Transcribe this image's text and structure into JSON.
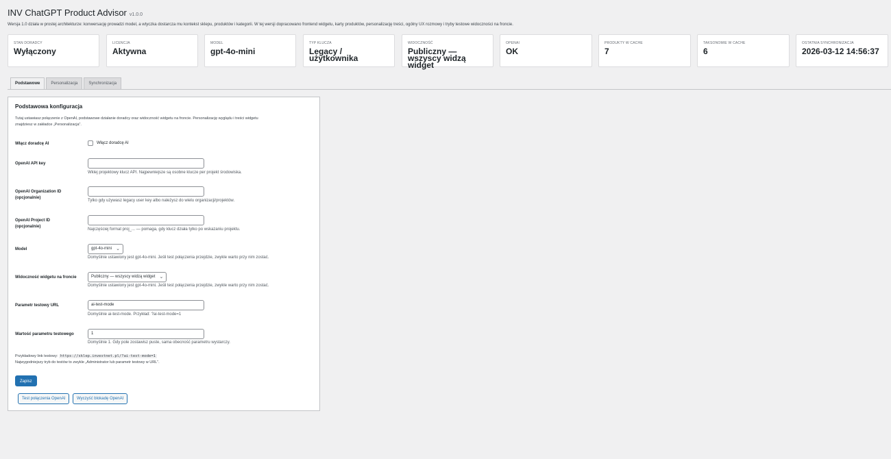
{
  "header": {
    "title": "INV ChatGPT Product Advisor",
    "version": "v1.0.0",
    "description": "Wersja 1.0 działa w prostej architekturze: konwersację prowadzi model, a wtyczka dostarcza mu kontekst sklepu, produktów i kategorii. W tej wersji dopracowano frontend widgetu, karty produktów, personalizację treści, ogólny UX rozmowy i tryby testowe widoczności na froncie."
  },
  "cards": [
    {
      "label": "Stan doradcy",
      "value": "Wyłączony"
    },
    {
      "label": "Licencja",
      "value": "Aktywna"
    },
    {
      "label": "Model",
      "value": "gpt-4o-mini"
    },
    {
      "label": "Typ klucza",
      "value": "Legacy / użytkownika"
    },
    {
      "label": "Widoczność",
      "value": "Publiczny — wszyscy widzą widget"
    },
    {
      "label": "OpenAI",
      "value": "OK"
    },
    {
      "label": "Produkty w cache",
      "value": "7"
    },
    {
      "label": "Taksonomie w cache",
      "value": "6"
    },
    {
      "label": "Ostatnia synchronizacja",
      "value": "2026-03-12 14:56:37"
    }
  ],
  "tabs": [
    "Podstawowe",
    "Personalizacja",
    "Synchronizacja"
  ],
  "panel": {
    "title": "Podstawowa konfiguracja",
    "intro": "Tutaj ustawiasz połączenie z OpenAI, podstawowe działanie doradcy oraz widoczność widgetu na froncie. Personalizację wyglądu i treści widgetu znajdziesz w zakładce „Personalizacja”.",
    "enable": {
      "label": "Włącz doradcę AI",
      "checkbox_text": "Włącz doradcę AI"
    },
    "api_key": {
      "label": "OpenAI API key",
      "value": "",
      "help": "Wklej projektowy klucz API. Najpewniejsze są osobne klucze per projekt środowiska."
    },
    "org_id": {
      "label": "OpenAI Organization ID (opcjonalnie)",
      "value": "",
      "help": "Tylko gdy używasz legacy user key albo należysz do wielu organizacji/projektów."
    },
    "project_id": {
      "label": "OpenAI Project ID (opcjonalnie)",
      "value": "",
      "help": "Najczęściej format proj_... — pomaga, gdy klucz działa tylko po wskazaniu projektu."
    },
    "model": {
      "label": "Model",
      "value": "gpt-4o-mini",
      "help": "Domyślnie ustawiony jest gpt-4o-mini. Jeśli test połączenia przejdzie, zwykle warto przy nim zostać."
    },
    "visibility": {
      "label": "Widoczność widgetu na froncie",
      "value": "Publiczny — wszyscy widzą widget",
      "help": "Domyślnie ustawiony jest gpt-4o-mini. Jeśli test połączenia przejdzie, zwykle warto przy nim zostać."
    },
    "test_param": {
      "label": "Parametr testowy URL",
      "value": "ai-test-mode",
      "help": "Domyślnie ai-test-mode. Przykład: ?ai-test-mode=1"
    },
    "test_value": {
      "label": "Wartość parametru testowego",
      "value": "1",
      "help": "Domyślnie 1. Gdy pole zostawisz puste, sama obecność parametru wystarczy."
    },
    "example_label": "Przykładowy link testowy:",
    "example_url": "https://sklep.investnet.pl/?ai-test-mode=1",
    "example_note": "Najwygodniejszy tryb do testów to zwykle „Administrator lub parametr testowy w URL”.",
    "save_label": "Zapisz",
    "test_button": "Test połączenia OpenAI",
    "clear_button": "Wyczyść blokadę OpenAI"
  },
  "colors": {
    "accent": "#2271b1",
    "background": "#f0f0f1"
  }
}
